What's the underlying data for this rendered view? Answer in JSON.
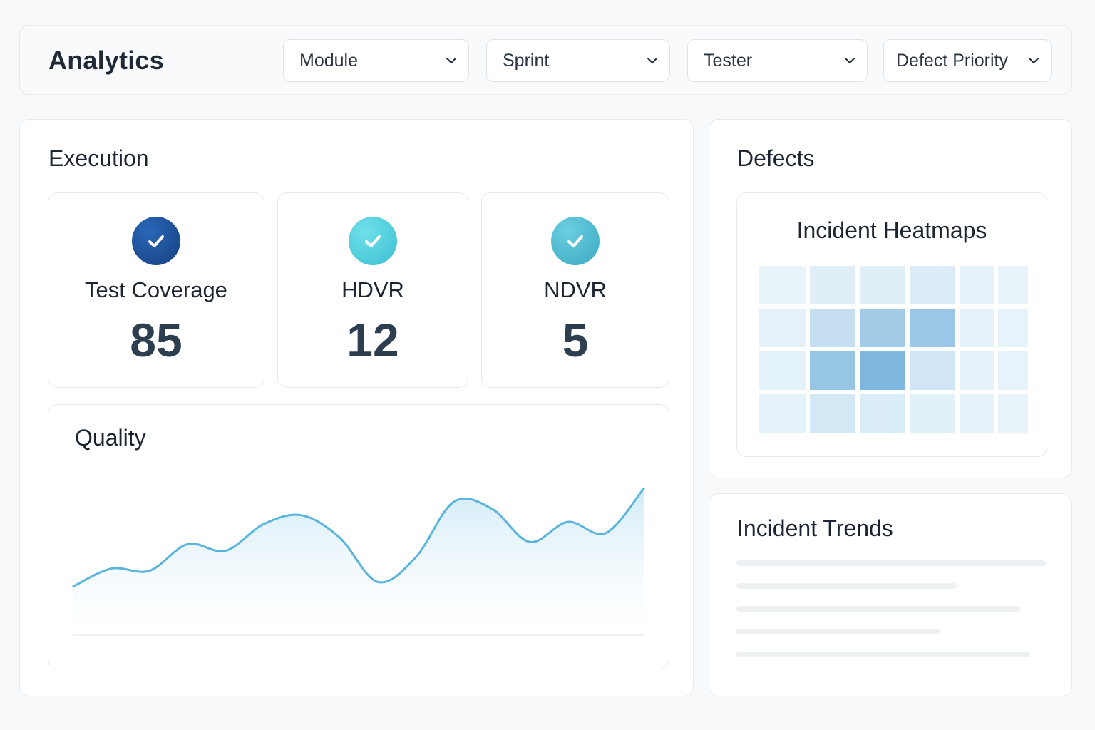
{
  "header": {
    "title": "Analytics",
    "filters": [
      {
        "label": "Module"
      },
      {
        "label": "Sprint"
      },
      {
        "label": "Tester"
      },
      {
        "label": "Defect Priority"
      }
    ]
  },
  "execution": {
    "title": "Execution",
    "kpis": [
      {
        "label": "Test Coverage",
        "value": "85",
        "color": "#1f4f98",
        "icon": "check-icon"
      },
      {
        "label": "HDVR",
        "value": "12",
        "color": "#4fcfdc",
        "icon": "check-icon"
      },
      {
        "label": "NDVR",
        "value": "5",
        "color": "#4cb8cf",
        "icon": "check-icon"
      }
    ]
  },
  "quality": {
    "title": "Quality",
    "chart_data": {
      "type": "area",
      "title": "",
      "xlabel": "",
      "ylabel": "",
      "grid": false,
      "color": "#5ab4dc",
      "values": [
        22,
        30,
        29,
        41,
        38,
        50,
        54,
        44,
        24,
        35,
        60,
        57,
        42,
        51,
        46,
        66
      ]
    }
  },
  "defects": {
    "title": "Defects",
    "heatmap": {
      "title": "Incident Heatmaps",
      "chart_data": {
        "type": "heatmap",
        "rows": 4,
        "cols": 6,
        "values": [
          [
            0.05,
            0.12,
            0.12,
            0.14,
            0.08,
            0.05
          ],
          [
            0.08,
            0.3,
            0.55,
            0.6,
            0.08,
            0.06
          ],
          [
            0.09,
            0.62,
            0.8,
            0.22,
            0.08,
            0.06
          ],
          [
            0.07,
            0.2,
            0.15,
            0.1,
            0.07,
            0.05
          ]
        ]
      }
    }
  },
  "trends": {
    "title": "Incident Trends",
    "placeholder_lines": 5
  }
}
